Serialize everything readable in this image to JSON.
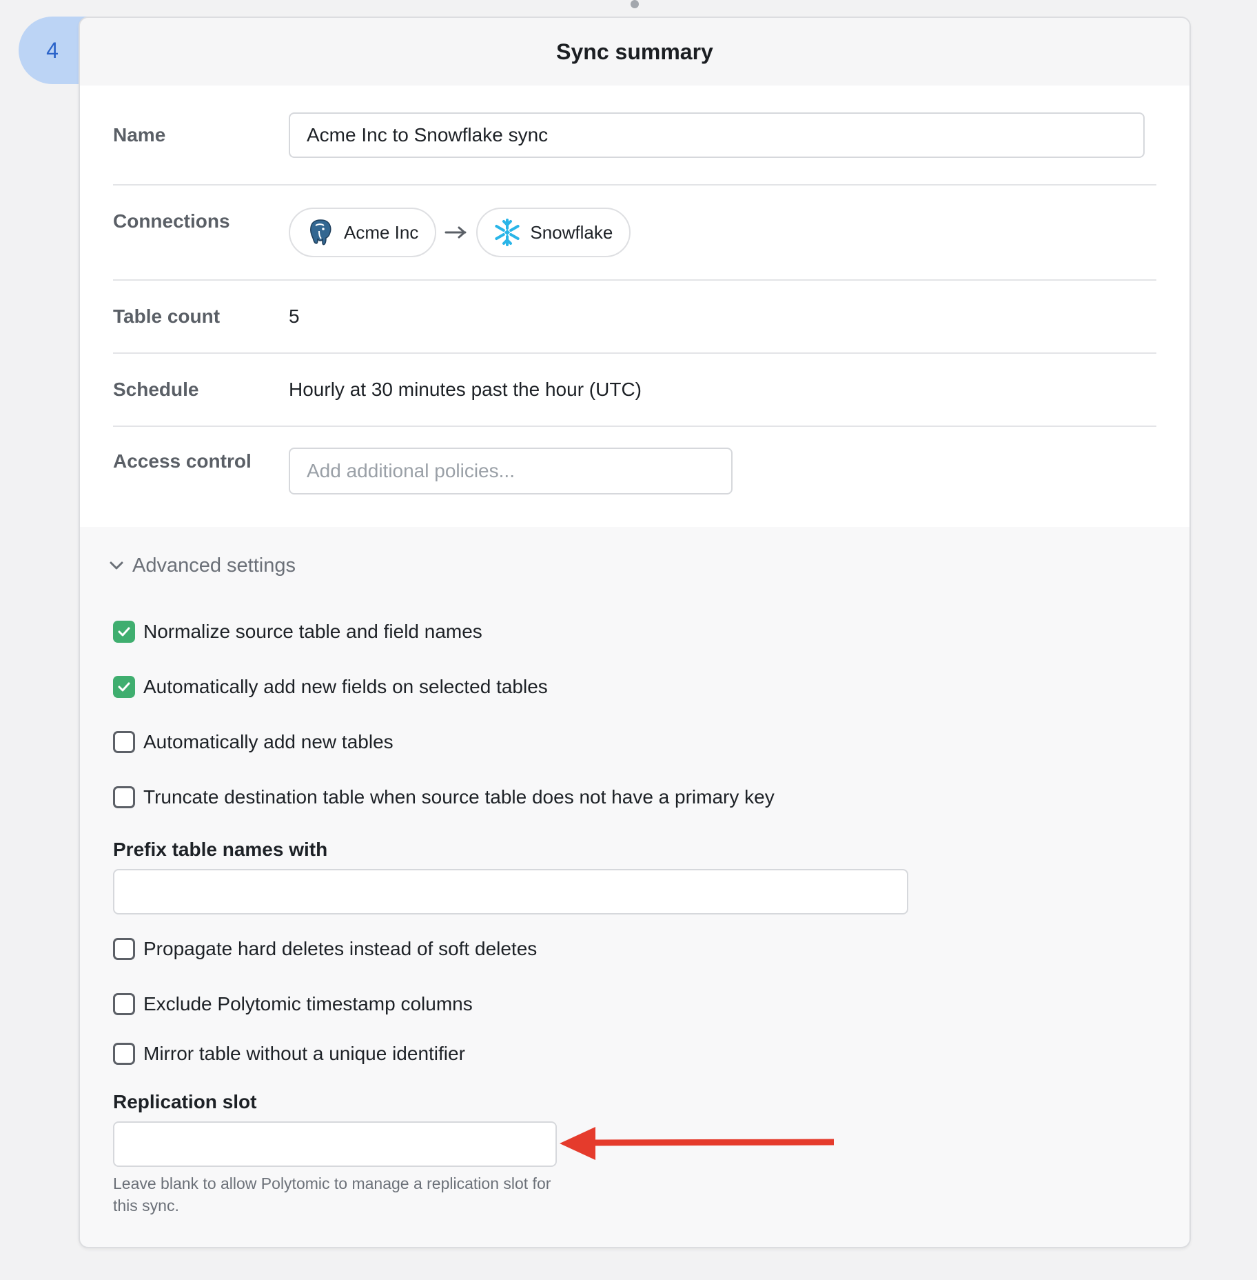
{
  "step": {
    "number": "4"
  },
  "header": {
    "title": "Sync summary"
  },
  "summary": {
    "name": {
      "label": "Name",
      "value": "Acme Inc to Snowflake sync"
    },
    "connections": {
      "label": "Connections",
      "source": "Acme Inc",
      "destination": "Snowflake",
      "source_icon": "postgres-elephant-icon",
      "destination_icon": "snowflake-icon"
    },
    "table_count": {
      "label": "Table count",
      "value": "5"
    },
    "schedule": {
      "label": "Schedule",
      "value": "Hourly at 30 minutes past the hour (UTC)"
    },
    "access_control": {
      "label": "Access control",
      "placeholder": "Add additional policies..."
    }
  },
  "advanced": {
    "toggle_label": "Advanced settings",
    "options": [
      {
        "label": "Normalize source table and field names",
        "checked": true
      },
      {
        "label": "Automatically add new fields on selected tables",
        "checked": true
      },
      {
        "label": "Automatically add new tables",
        "checked": false
      },
      {
        "label": "Truncate destination table when source table does not have a primary key",
        "checked": false
      }
    ],
    "prefix": {
      "label": "Prefix table names with",
      "value": ""
    },
    "options2": [
      {
        "label": "Propagate hard deletes instead of soft deletes",
        "checked": false
      },
      {
        "label": "Exclude Polytomic timestamp columns",
        "checked": false
      },
      {
        "label": "Mirror table without a unique identifier",
        "checked": false
      }
    ],
    "replication_slot": {
      "label": "Replication slot",
      "value": "",
      "help": "Leave blank to allow Polytomic to manage a replication slot for this sync."
    }
  },
  "colors": {
    "accent_blue": "#2a63c9",
    "badge_bg": "#bcd4f5",
    "check_green": "#3fae6f",
    "annotation_red": "#e53b2c",
    "snowflake_blue": "#29b5e8"
  }
}
